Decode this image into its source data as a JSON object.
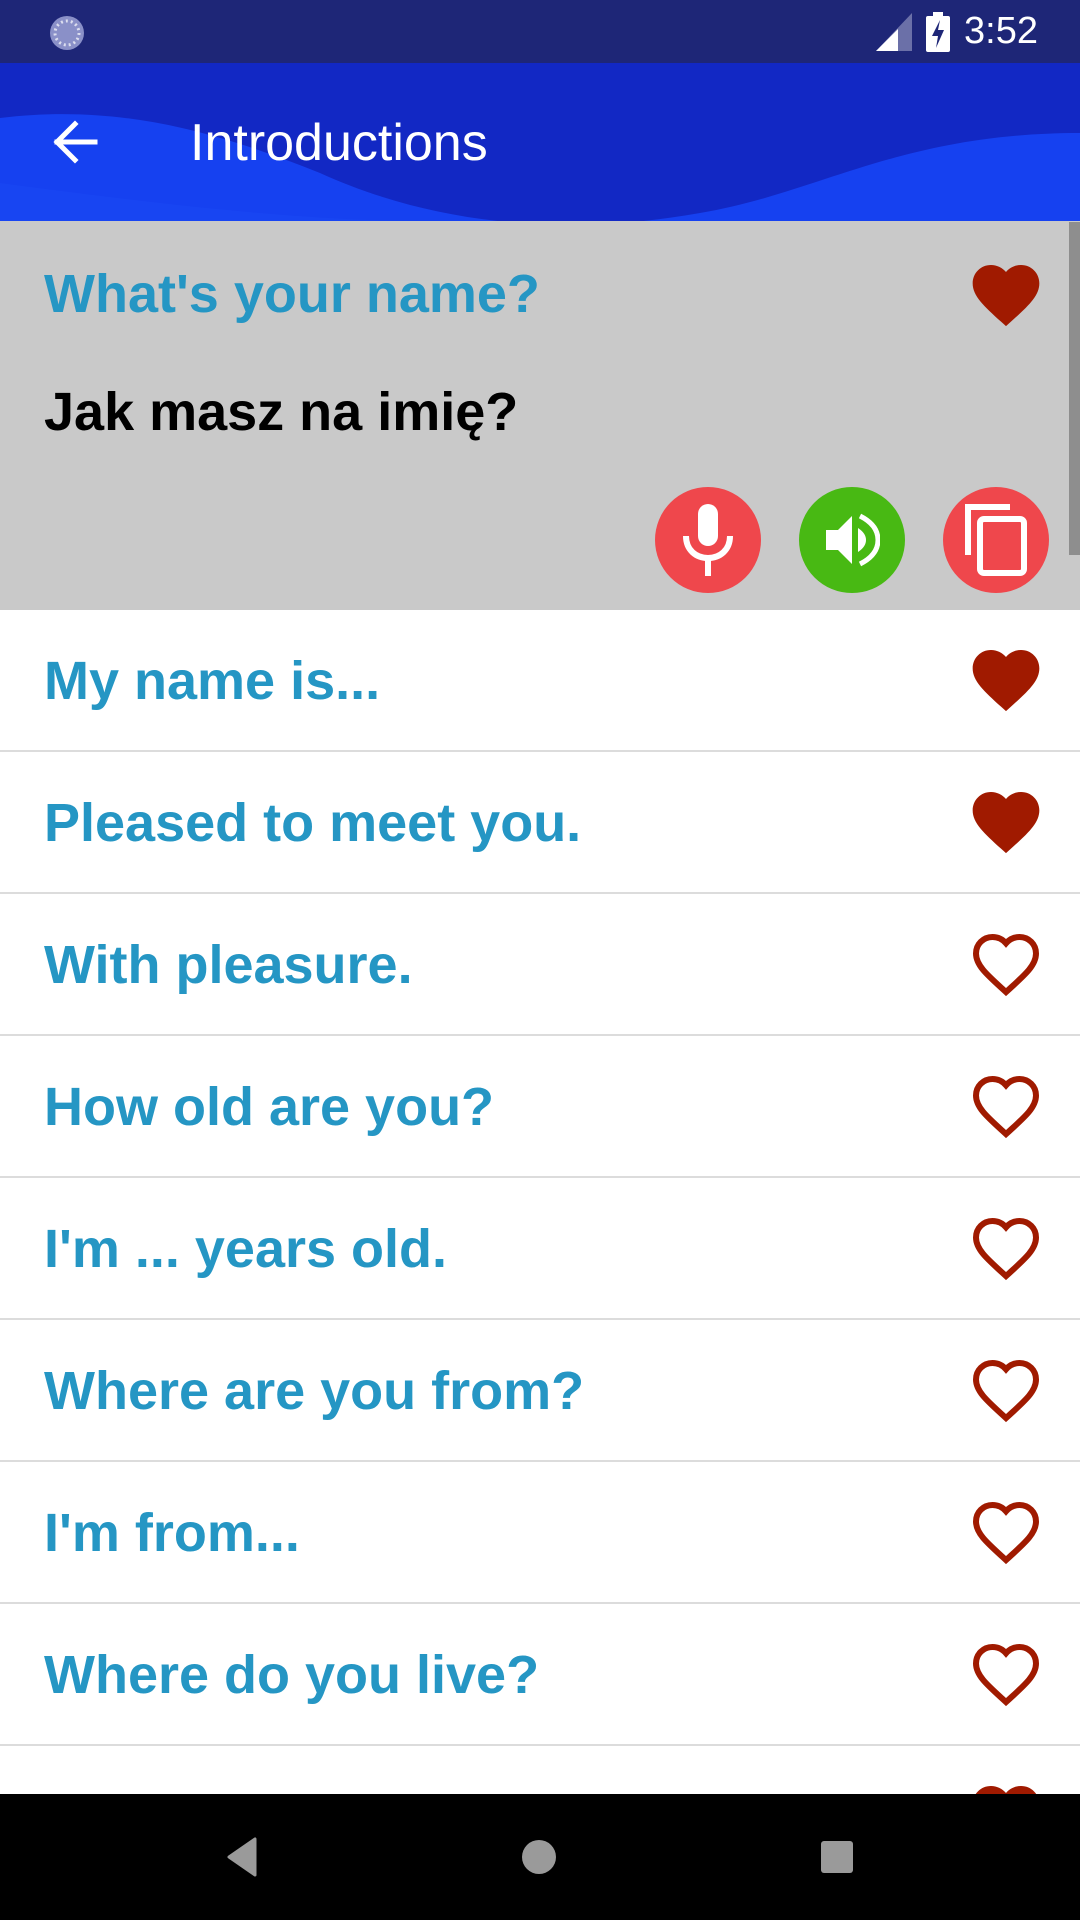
{
  "status_bar": {
    "time": "3:52",
    "left_icon": "sync-indicator-icon",
    "signal_icon": "cellular-signal-icon",
    "battery_icon": "battery-charging-icon"
  },
  "app_bar": {
    "title": "Introductions",
    "back_icon": "arrow-back-icon",
    "colors": {
      "background": "#1228c4",
      "wave": "#1641f0"
    }
  },
  "selected_phrase": {
    "english": "What's your name?",
    "translation": "Jak masz na imię?",
    "favorite": true,
    "actions": [
      {
        "name": "record",
        "icon": "microphone-icon",
        "color": "#ef474c"
      },
      {
        "name": "play",
        "icon": "speaker-icon",
        "color": "#48b913"
      },
      {
        "name": "copy",
        "icon": "copy-icon",
        "color": "#ef474c"
      }
    ]
  },
  "phrases": [
    {
      "text": "My name is...",
      "favorite": true
    },
    {
      "text": "Pleased to meet you.",
      "favorite": true
    },
    {
      "text": "With pleasure.",
      "favorite": false
    },
    {
      "text": "How old are you?",
      "favorite": false
    },
    {
      "text": "I'm ... years old.",
      "favorite": false
    },
    {
      "text": "Where are you from?",
      "favorite": false
    },
    {
      "text": "I'm from...",
      "favorite": false
    },
    {
      "text": "Where do you live?",
      "favorite": false
    },
    {
      "text": "",
      "favorite": true
    }
  ],
  "colors": {
    "phrase_text": "#2596c4",
    "heart": "#a01a00",
    "selected_bg": "#c9c9c9"
  },
  "nav_bar": {
    "back": "nav-back-icon",
    "home": "nav-home-icon",
    "recents": "nav-recents-icon"
  }
}
